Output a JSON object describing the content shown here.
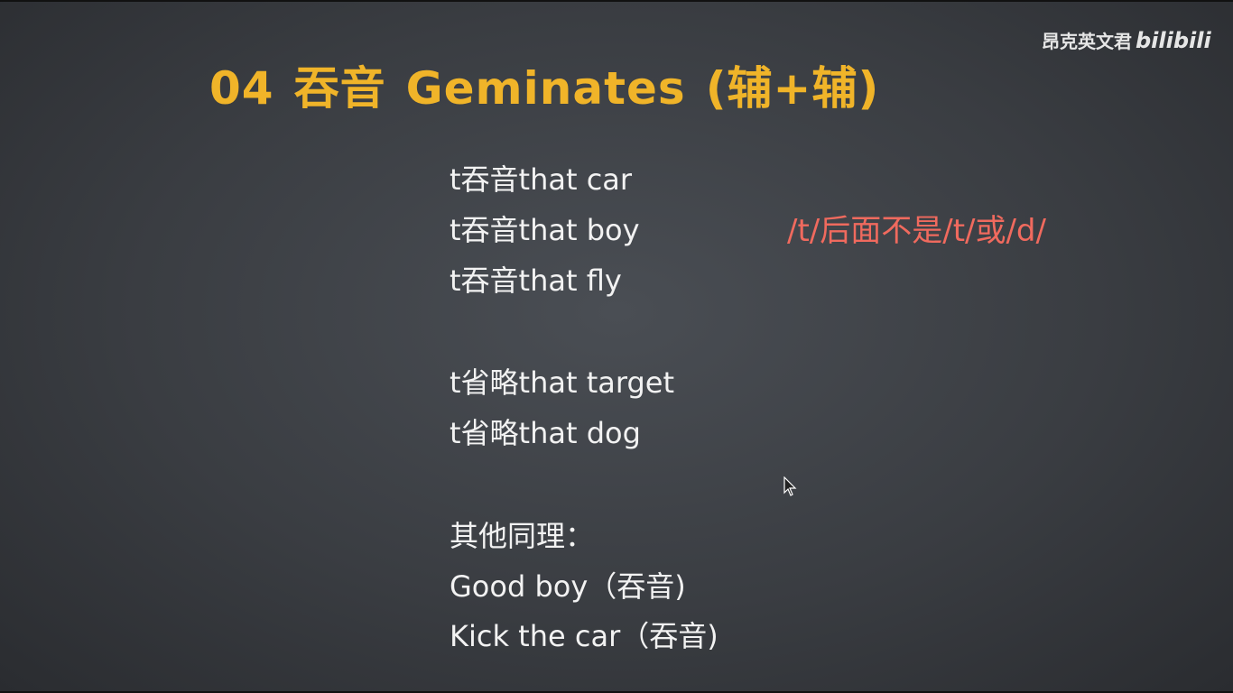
{
  "watermark": {
    "channel": "昂克英文君",
    "logo": "bilibili"
  },
  "title": {
    "number": "04",
    "chinese": "吞音",
    "english": "Geminates",
    "note": "(辅+辅)"
  },
  "rule_note": "/t/后面不是/t/或/d/",
  "lines": [
    {
      "text": "t吞音that car"
    },
    {
      "text": "t吞音that boy"
    },
    {
      "text": "t吞音that fly"
    },
    {
      "text": "t省略that target"
    },
    {
      "text": "t省略that dog"
    },
    {
      "text": "其他同理："
    },
    {
      "text": "Good boy（吞音)"
    },
    {
      "text": "Kick the car（吞音)"
    }
  ],
  "colors": {
    "title": "#f0b429",
    "note": "#f06a5e",
    "text": "#f2f2f2",
    "board": "#3a3d42"
  }
}
